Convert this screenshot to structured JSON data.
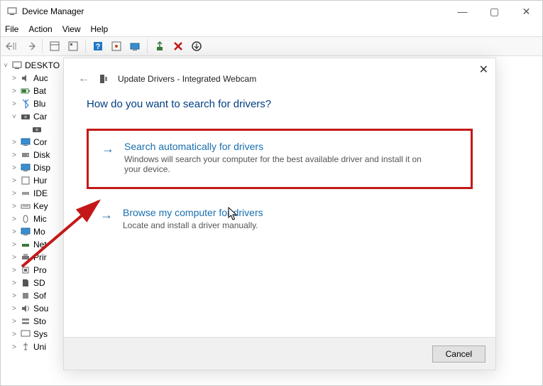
{
  "window": {
    "title": "Device Manager",
    "menus": {
      "file": "File",
      "action": "Action",
      "view": "View",
      "help": "Help"
    }
  },
  "winbtns": {
    "min": "—",
    "max": "▢",
    "close": "✕"
  },
  "tree": {
    "root": "DESKTO",
    "items": [
      {
        "label": "Auc",
        "icon": "speaker"
      },
      {
        "label": "Bat",
        "icon": "battery"
      },
      {
        "label": "Blu",
        "icon": "bluetooth"
      },
      {
        "label": "Car",
        "icon": "camera",
        "expanded": true,
        "child": ""
      },
      {
        "label": "Cor",
        "icon": "monitor"
      },
      {
        "label": "Disk",
        "icon": "disk"
      },
      {
        "label": "Disp",
        "icon": "monitor"
      },
      {
        "label": "Hur",
        "icon": "hid"
      },
      {
        "label": "IDE",
        "icon": "ide"
      },
      {
        "label": "Key",
        "icon": "keyboard"
      },
      {
        "label": "Mic",
        "icon": "mouse"
      },
      {
        "label": "Mo",
        "icon": "monitor"
      },
      {
        "label": "Net",
        "icon": "network"
      },
      {
        "label": "Prir",
        "icon": "printer"
      },
      {
        "label": "Pro",
        "icon": "cpu"
      },
      {
        "label": "SD",
        "icon": "sd"
      },
      {
        "label": "Sof",
        "icon": "software"
      },
      {
        "label": "Sou",
        "icon": "sound"
      },
      {
        "label": "Sto",
        "icon": "storage"
      },
      {
        "label": "Sys",
        "icon": "system"
      },
      {
        "label": "Uni",
        "icon": "usb"
      }
    ]
  },
  "dialog": {
    "title": "Update Drivers - Integrated Webcam",
    "question": "How do you want to search for drivers?",
    "option1": {
      "title": "Search automatically for drivers",
      "desc": "Windows will search your computer for the best available driver and install it on your device."
    },
    "option2": {
      "title": "Browse my computer for drivers",
      "desc": "Locate and install a driver manually."
    },
    "cancel": "Cancel"
  }
}
